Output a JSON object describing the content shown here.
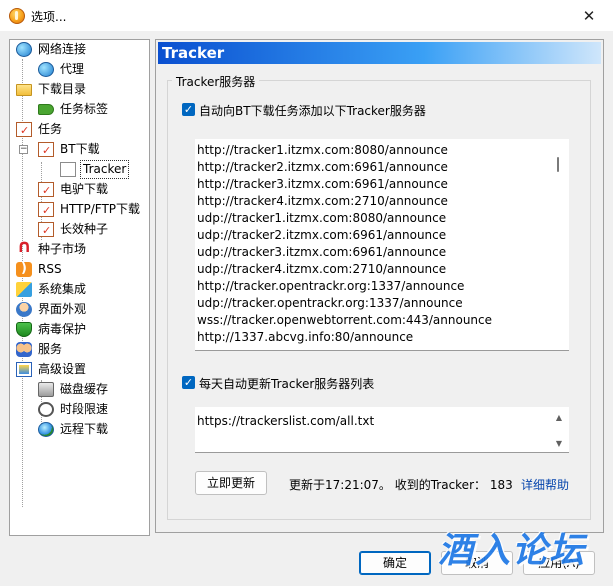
{
  "window": {
    "title": "选项..."
  },
  "tree": [
    {
      "label": "网络连接",
      "icon": "network-globe-icon"
    },
    {
      "label": "代理",
      "icon": "proxy-globe-icon"
    },
    {
      "label": "下载目录",
      "icon": "folder-icon"
    },
    {
      "label": "任务标签",
      "icon": "tag-icon"
    },
    {
      "label": "任务",
      "icon": "task-icon"
    },
    {
      "label": "BT下载",
      "icon": "task-icon"
    },
    {
      "label": "Tracker",
      "icon": "file-icon",
      "selected": true
    },
    {
      "label": "电驴下载",
      "icon": "task-icon"
    },
    {
      "label": "HTTP/FTP下载",
      "icon": "task-icon"
    },
    {
      "label": "长效种子",
      "icon": "task-icon"
    },
    {
      "label": "种子市场",
      "icon": "magnet-icon"
    },
    {
      "label": "RSS",
      "icon": "rss-icon"
    },
    {
      "label": "系统集成",
      "icon": "integration-icon"
    },
    {
      "label": "界面外观",
      "icon": "appearance-icon"
    },
    {
      "label": "病毒保护",
      "icon": "shield-icon"
    },
    {
      "label": "服务",
      "icon": "users-icon"
    },
    {
      "label": "高级设置",
      "icon": "advanced-icon"
    },
    {
      "label": "磁盘缓存",
      "icon": "disk-icon"
    },
    {
      "label": "时段限速",
      "icon": "clock-icon"
    },
    {
      "label": "远程下载",
      "icon": "globe-icon"
    }
  ],
  "panel": {
    "header": "Tracker",
    "group_title": "Tracker服务器",
    "auto_add": {
      "label": "自动向BT下载任务添加以下Tracker服务器",
      "checked": true
    },
    "trackers": [
      "http://tracker1.itzmx.com:8080/announce",
      "http://tracker2.itzmx.com:6961/announce",
      "http://tracker3.itzmx.com:6961/announce",
      "http://tracker4.itzmx.com:2710/announce",
      "udp://tracker1.itzmx.com:8080/announce",
      "udp://tracker2.itzmx.com:6961/announce",
      "udp://tracker3.itzmx.com:6961/announce",
      "udp://tracker4.itzmx.com:2710/announce",
      "http://tracker.opentrackr.org:1337/announce",
      "udp://tracker.opentrackr.org:1337/announce",
      "wss://tracker.openwebtorrent.com:443/announce",
      "http://1337.abcvg.info:80/announce"
    ],
    "auto_update": {
      "label": "每天自动更新Tracker服务器列表",
      "checked": true
    },
    "update_url": "https://trackerslist.com/all.txt",
    "update_now_label": "立即更新",
    "status_text": "更新于17:21:07。 收到的Tracker： 183",
    "help_link": "详细帮助"
  },
  "footer": {
    "ok_label": "确定",
    "cancel_label": "取消",
    "apply_label": "应用(A)"
  },
  "watermark": "酒入论坛",
  "colors": {
    "accent": "#0067c0",
    "header_start": "#0a4fd0",
    "link": "#0645ad"
  }
}
